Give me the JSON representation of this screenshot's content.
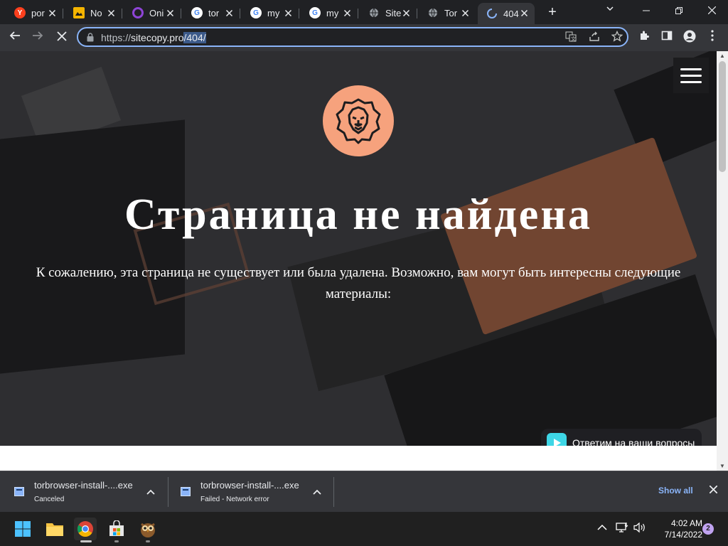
{
  "browser": {
    "tabs": [
      {
        "title": "por",
        "icon": "yandex-icon",
        "color": "#fc3f1d",
        "glyph": "Y"
      },
      {
        "title": "No",
        "icon": "slides-icon",
        "color": "#f4b400",
        "glyph": ""
      },
      {
        "title": "Oni",
        "icon": "ring-icon",
        "color": "#8e44d6",
        "glyph": ""
      },
      {
        "title": "tor",
        "icon": "google-icon",
        "color": "#ffffff",
        "glyph": "G"
      },
      {
        "title": "my",
        "icon": "google-icon",
        "color": "#ffffff",
        "glyph": "G"
      },
      {
        "title": "my",
        "icon": "google-icon",
        "color": "#ffffff",
        "glyph": "G"
      },
      {
        "title": "Site",
        "icon": "globe-icon",
        "color": "#9aa0a6",
        "glyph": ""
      },
      {
        "title": "Tor",
        "icon": "globe-icon",
        "color": "#9aa0a6",
        "glyph": ""
      },
      {
        "title": "404",
        "icon": "loading-icon",
        "color": "#8ab4f8",
        "glyph": "",
        "active": true
      }
    ],
    "new_tab": "+",
    "url_scheme": "https://",
    "url_host": "sitecopy.pro",
    "url_path": "/404/"
  },
  "page": {
    "heading": "Страница не найдена",
    "lead": "К сожалению, эта страница не существует или была удалена. Возможно, вам могут быть интересны следующие материалы:",
    "chat_label": "Ответим на ваши вопросы"
  },
  "downloads": [
    {
      "name": "torbrowser-install-....exe",
      "status": "Canceled"
    },
    {
      "name": "torbrowser-install-....exe",
      "status": "Failed - Network error"
    }
  ],
  "shelf": {
    "show_all": "Show all"
  },
  "taskbar": {
    "time": "4:02 AM",
    "date": "7/14/2022",
    "notifications": "2"
  },
  "colors": {
    "accent": "#8ab4f8",
    "logo_bg": "#f6a27d",
    "chat_icon": "#3ed6e6"
  }
}
